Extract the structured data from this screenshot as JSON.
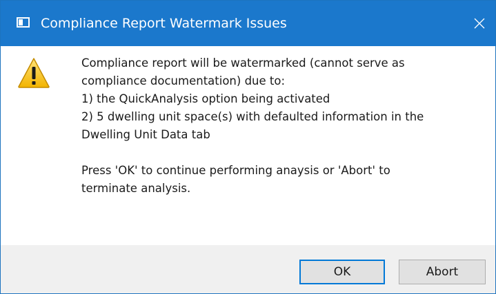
{
  "dialog": {
    "title": "Compliance Report Watermark Issues",
    "icons": {
      "app": "window-app-icon",
      "close": "close-icon",
      "warning": "warning-triangle-icon"
    },
    "colors": {
      "titlebar": "#1b78cc",
      "footer": "#f0f0f0",
      "default_button_border": "#0078d7"
    }
  },
  "message": {
    "lines": [
      "Compliance report will be watermarked (cannot serve as",
      "compliance documentation) due to:",
      "1) the QuickAnalysis option being activated",
      "2) 5 dwelling unit space(s) with defaulted information in the",
      "Dwelling Unit Data tab",
      "",
      "Press 'OK' to continue performing anaysis or 'Abort' to",
      "terminate analysis."
    ]
  },
  "buttons": {
    "ok": "OK",
    "abort": "Abort"
  }
}
